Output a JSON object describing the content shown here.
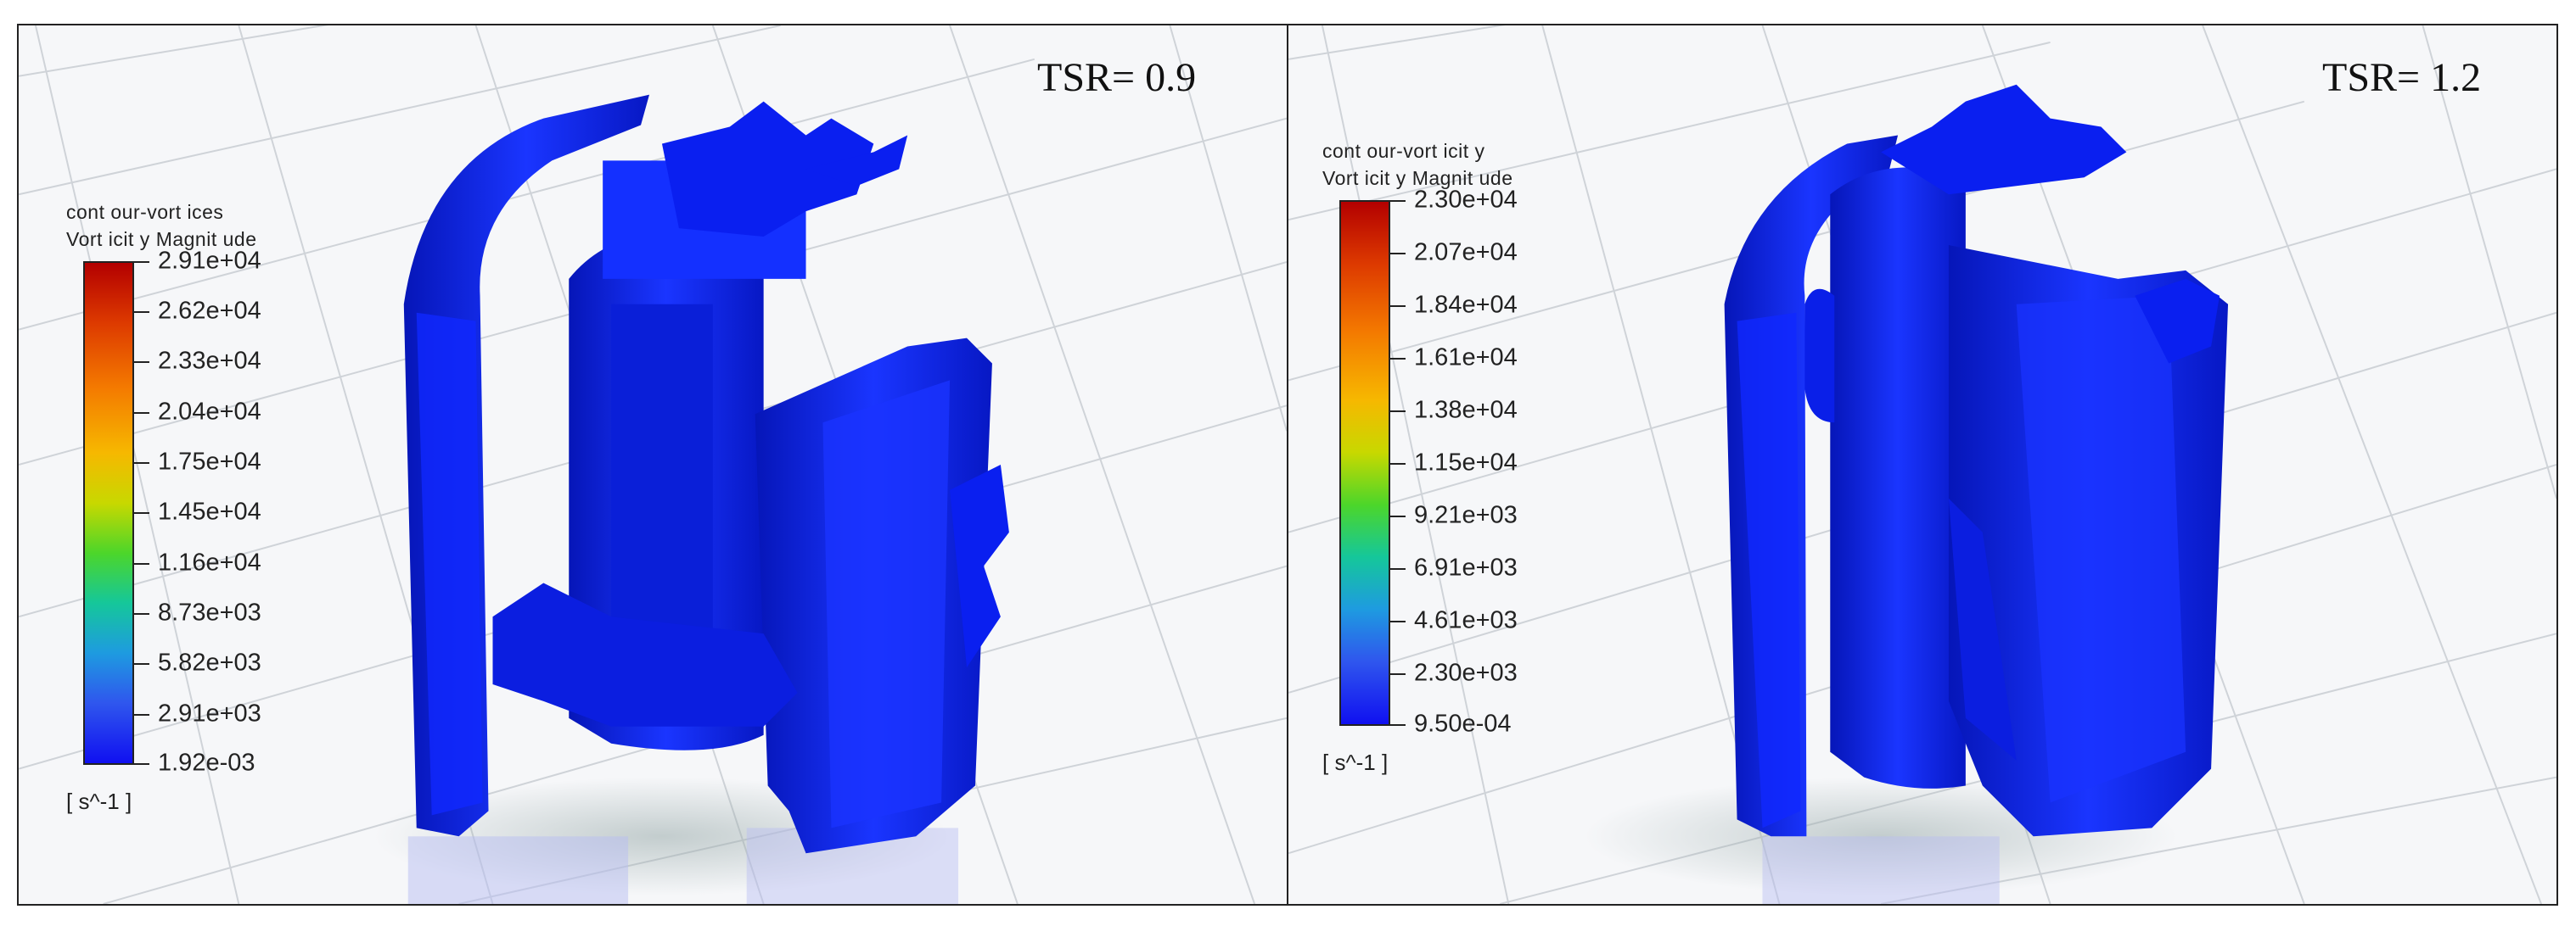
{
  "panels": [
    {
      "tsr_label": "TSR= 0.9",
      "legend": {
        "title_line1": "cont our-vort ices",
        "title_line2": "Vort icit y Magnit ude",
        "ticks": [
          "2.91e+04",
          "2.62e+04",
          "2.33e+04",
          "2.04e+04",
          "1.75e+04",
          "1.45e+04",
          "1.16e+04",
          "8.73e+03",
          "5.82e+03",
          "2.91e+03",
          "1.92e-03"
        ],
        "unit": "[ s^-1 ]"
      }
    },
    {
      "tsr_label": "TSR= 1.2",
      "legend": {
        "title_line1": "cont our-vort icit y",
        "title_line2": "Vort icit y Magnit ude",
        "ticks": [
          "2.30e+04",
          "2.07e+04",
          "1.84e+04",
          "1.61e+04",
          "1.38e+04",
          "1.15e+04",
          "9.21e+03",
          "6.91e+03",
          "4.61e+03",
          "2.30e+03",
          "9.50e-04"
        ],
        "unit": "[ s^-1 ]"
      }
    }
  ],
  "colors": {
    "vortex_blue": "#0a1ff0",
    "frame": "#222222"
  }
}
